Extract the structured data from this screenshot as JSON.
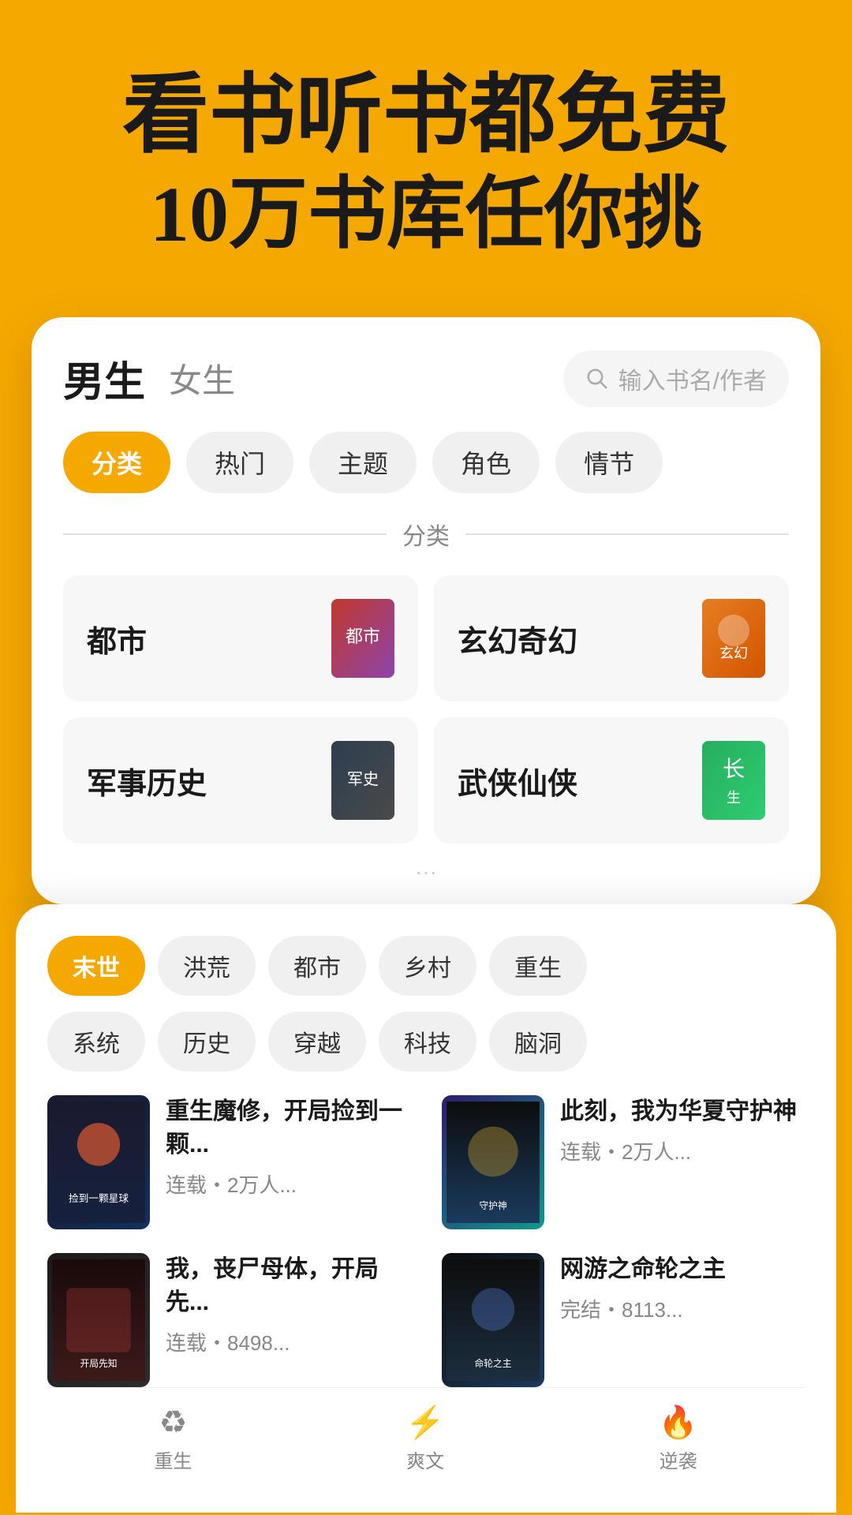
{
  "hero": {
    "line1": "看书听书都免费",
    "line2": "10万书库任你挑"
  },
  "tabs": {
    "male": "男生",
    "female": "女生"
  },
  "search": {
    "placeholder": "输入书名/作者"
  },
  "filters": [
    {
      "label": "分类",
      "active": true
    },
    {
      "label": "热门",
      "active": false
    },
    {
      "label": "主题",
      "active": false
    },
    {
      "label": "角色",
      "active": false
    },
    {
      "label": "情节",
      "active": false
    }
  ],
  "section": {
    "label": "分类"
  },
  "categories": [
    {
      "name": "都市",
      "cover_class": "cover-dushi"
    },
    {
      "name": "玄幻奇幻",
      "cover_class": "cover-xuanhuan"
    },
    {
      "name": "军事历史",
      "cover_class": "cover-junshi"
    },
    {
      "name": "武侠仙侠",
      "cover_class": "cover-wuxia"
    }
  ],
  "genre_tags_row1": [
    {
      "label": "末世",
      "active": true
    },
    {
      "label": "洪荒",
      "active": false
    },
    {
      "label": "都市",
      "active": false
    },
    {
      "label": "乡村",
      "active": false
    },
    {
      "label": "重生",
      "active": false
    }
  ],
  "genre_tags_row2": [
    {
      "label": "系统",
      "active": false
    },
    {
      "label": "历史",
      "active": false
    },
    {
      "label": "穿越",
      "active": false
    },
    {
      "label": "科技",
      "active": false
    },
    {
      "label": "脑洞",
      "active": false
    }
  ],
  "books": [
    {
      "title": "重生魔修，开局捡到一颗...",
      "meta": "连载・2万人...",
      "cover_class": "cover-book1"
    },
    {
      "title": "此刻，我为华夏守护神",
      "meta": "连载・2万人...",
      "cover_class": "cover-book2"
    },
    {
      "title": "我，丧尸母体，开局先...",
      "meta": "连载・8498...",
      "cover_class": "cover-book3"
    },
    {
      "title": "网游之命轮之主",
      "meta": "完结・8113...",
      "cover_class": "cover-book4"
    }
  ],
  "bottom_tabs": [
    {
      "label": "重生"
    },
    {
      "label": "爽文"
    },
    {
      "label": "逆袭"
    }
  ]
}
